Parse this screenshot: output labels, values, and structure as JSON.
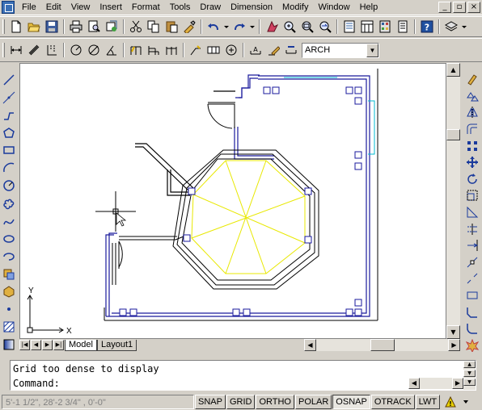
{
  "menu": {
    "items": [
      "File",
      "Edit",
      "View",
      "Insert",
      "Format",
      "Tools",
      "Draw",
      "Dimension",
      "Modify",
      "Window",
      "Help"
    ],
    "window_controls": [
      "_",
      "▫",
      "×"
    ]
  },
  "dimension_toolbar": {
    "dim_style": "ARCH"
  },
  "drawing": {
    "ucs_x": "X",
    "ucs_y": "Y"
  },
  "tabs": {
    "nav": [
      "|◀",
      "◀",
      "▶",
      "▶|"
    ],
    "items": [
      "Model",
      "Layout1"
    ],
    "active": "Model"
  },
  "command": {
    "history": "Grid too dense to display",
    "prompt": "Command:"
  },
  "status": {
    "coords": "5'-1 1/2\",  28'-2 3/4\" , 0'-0\"",
    "toggles": [
      {
        "label": "SNAP",
        "on": false
      },
      {
        "label": "GRID",
        "on": false
      },
      {
        "label": "ORTHO",
        "on": false
      },
      {
        "label": "POLAR",
        "on": false
      },
      {
        "label": "OSNAP",
        "on": true
      },
      {
        "label": "OTRACK",
        "on": false
      },
      {
        "label": "LWT",
        "on": false
      }
    ]
  },
  "colors": {
    "wall_blue": "#1a1a9c",
    "hatch_yellow": "#e8e800",
    "cyan": "#00b8d0",
    "window_bg": "#d4d0c8"
  }
}
